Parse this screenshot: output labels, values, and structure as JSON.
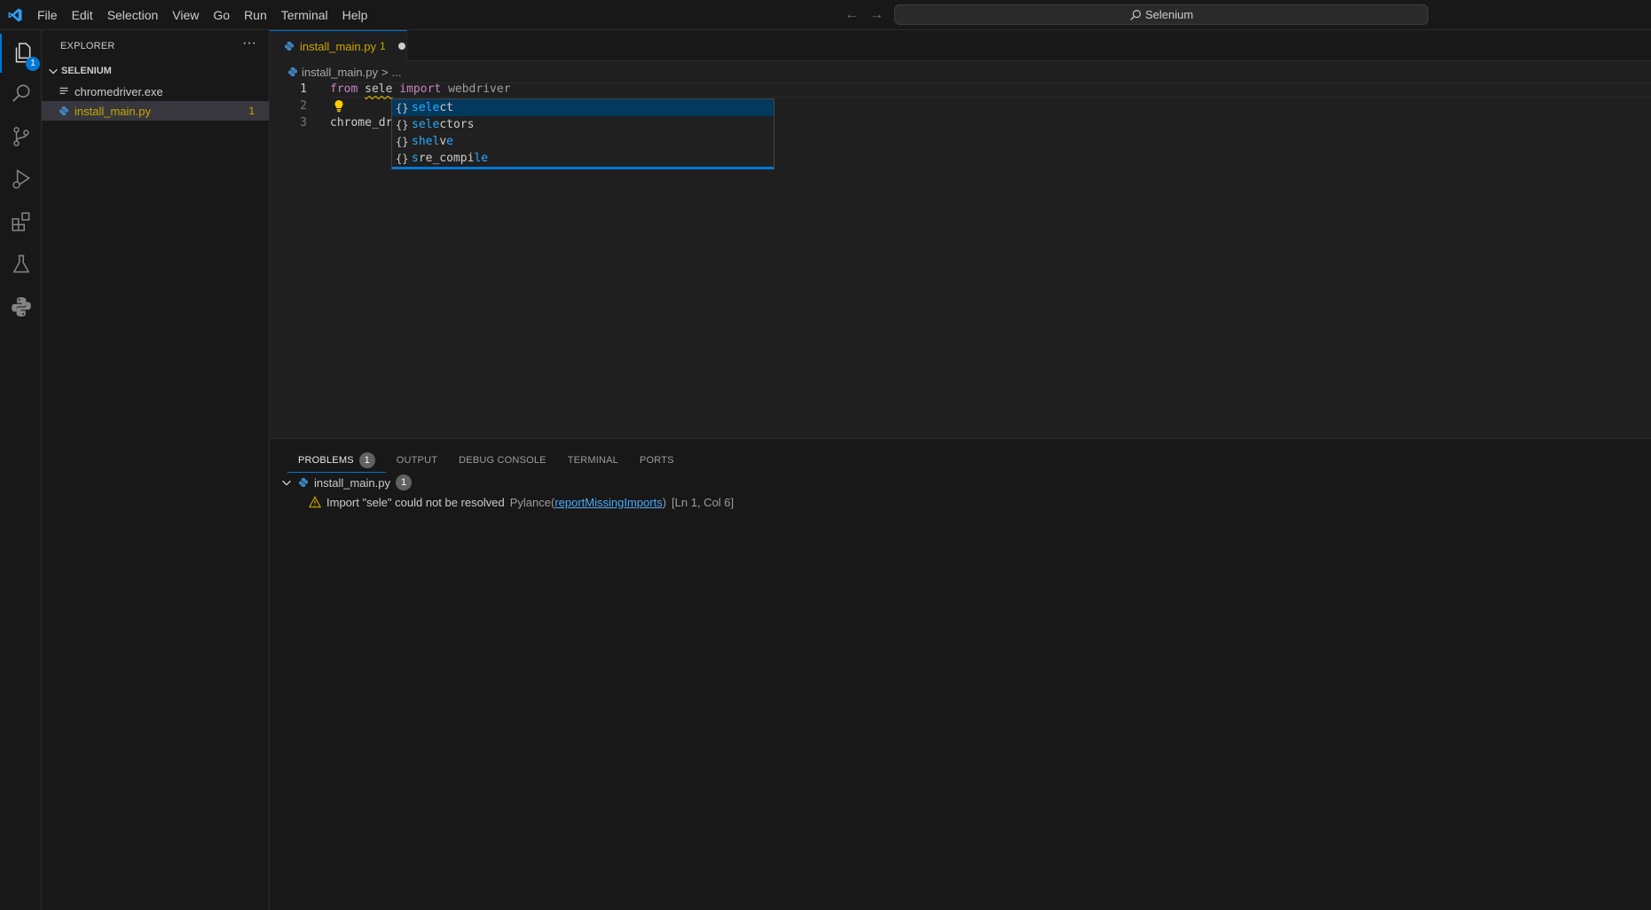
{
  "menubar": [
    "File",
    "Edit",
    "Selection",
    "View",
    "Go",
    "Run",
    "Terminal",
    "Help"
  ],
  "command_center": {
    "label": "Selenium"
  },
  "activity": {
    "explorer_badge": "1"
  },
  "sidebar": {
    "title": "EXPLORER",
    "more": "···",
    "folder": "SELENIUM",
    "files": [
      {
        "name": "chromedriver.exe",
        "badge": ""
      },
      {
        "name": "install_main.py",
        "badge": "1"
      }
    ]
  },
  "tab": {
    "label": "install_main.py",
    "badge": "1"
  },
  "breadcrumb": {
    "file": "install_main.py",
    "sep": ">",
    "rest": "..."
  },
  "editor": {
    "line_numbers": [
      "1",
      "2",
      "3"
    ],
    "line1": {
      "from": "from",
      "module": "sele",
      "import": "import",
      "name": "webdriver"
    },
    "line3": "chrome_dr"
  },
  "suggestions": [
    {
      "icon": "{}",
      "match": "sele",
      "rest": "ct"
    },
    {
      "icon": "{}",
      "match": "sele",
      "rest": "ctors"
    },
    {
      "icon": "{}",
      "parts": [
        "sh",
        "el",
        "v",
        "e"
      ]
    },
    {
      "icon": "{}",
      "parts": [
        "s",
        "r",
        "e_compi",
        "le"
      ]
    }
  ],
  "panel": {
    "tabs": [
      {
        "label": "PROBLEMS",
        "count": "1"
      },
      {
        "label": "OUTPUT"
      },
      {
        "label": "DEBUG CONSOLE"
      },
      {
        "label": "TERMINAL"
      },
      {
        "label": "PORTS"
      }
    ],
    "problem_file": "install_main.py",
    "problem_file_count": "1",
    "problem": {
      "message": "Import \"sele\" could not be resolved",
      "source": "Pylance",
      "code": "reportMissingImports",
      "location": "[Ln 1, Col 6]"
    }
  }
}
